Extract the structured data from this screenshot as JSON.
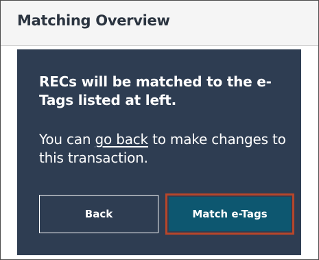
{
  "panel": {
    "title": "Matching Overview"
  },
  "card": {
    "headline": "RECs will be matched to the e-Tags listed at left.",
    "subtext_before": "You can ",
    "subtext_link": "go back",
    "subtext_after": " to make changes to this transaction."
  },
  "buttons": {
    "back_label": "Back",
    "match_label": "Match e-Tags"
  },
  "colors": {
    "card_background": "#2e3d52",
    "primary_button": "#0d5770",
    "highlight_outline": "#b8462a"
  }
}
